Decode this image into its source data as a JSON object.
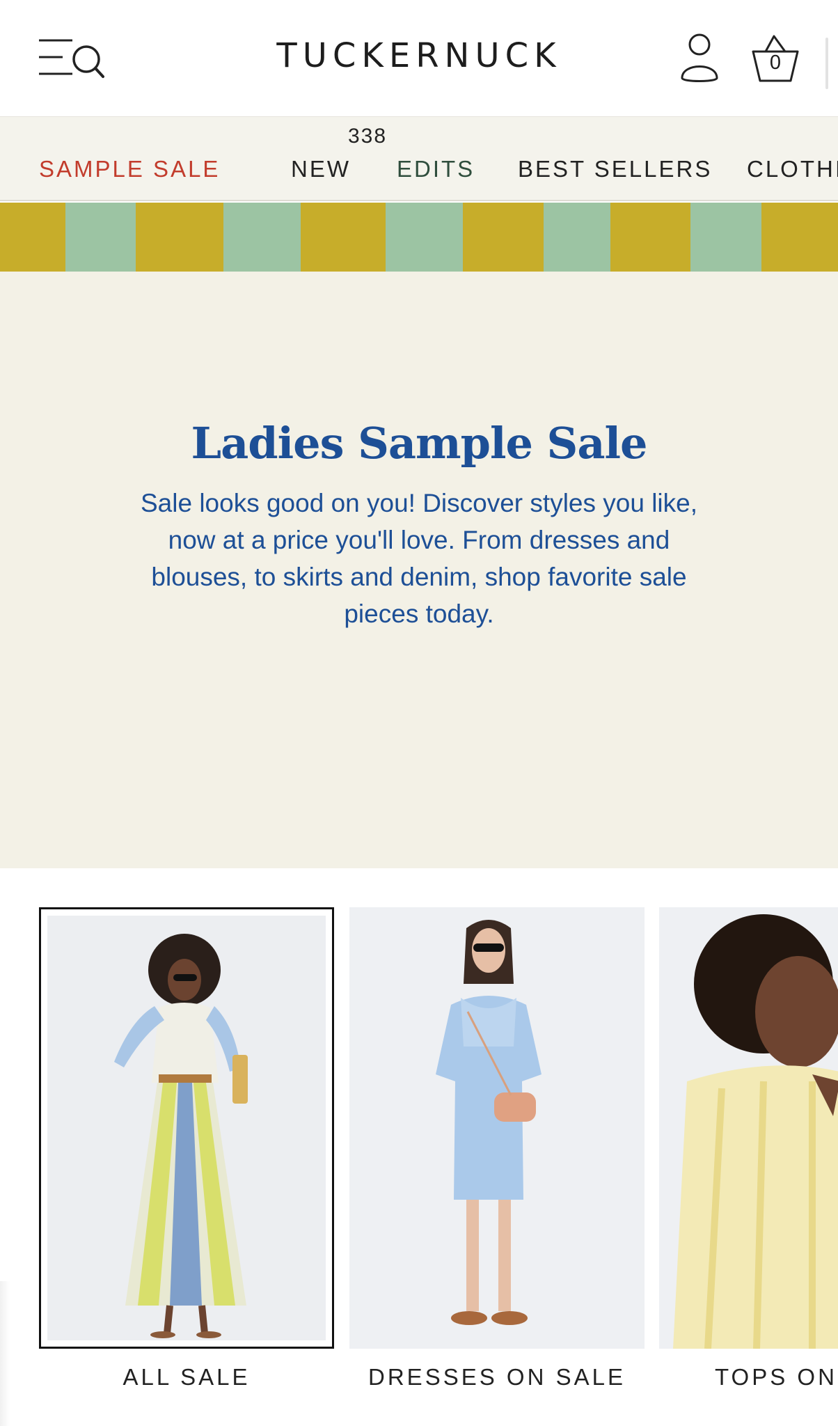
{
  "header": {
    "logo": "TUCKERNUCK",
    "cart_count": "0",
    "icons": {
      "menu": "menu-search-icon",
      "account": "user-icon",
      "cart": "basket-icon"
    }
  },
  "nav": {
    "items": [
      {
        "label": "SAMPLE SALE",
        "color": "#c23c2c"
      },
      {
        "label": "NEW",
        "badge": "338"
      },
      {
        "label": "EDITS",
        "color": "#2f4e3d"
      },
      {
        "label": "BEST SELLERS"
      },
      {
        "label": "CLOTHING"
      }
    ]
  },
  "banner": {
    "stripe_colors": [
      "#c7ad2a",
      "#9cc4a3"
    ]
  },
  "hero": {
    "title": "Ladies Sample Sale",
    "body": "Sale looks good on you! Discover styles you like, now at a price you'll love. From dresses and blouses, to skirts and denim, shop favorite sale pieces today.",
    "text_color": "#1d4f96",
    "background": "#f3f1e6"
  },
  "categories": [
    {
      "label": "ALL SALE",
      "selected": true
    },
    {
      "label": "DRESSES ON SALE",
      "selected": false
    },
    {
      "label": "TOPS ON SALE",
      "selected": false
    }
  ]
}
